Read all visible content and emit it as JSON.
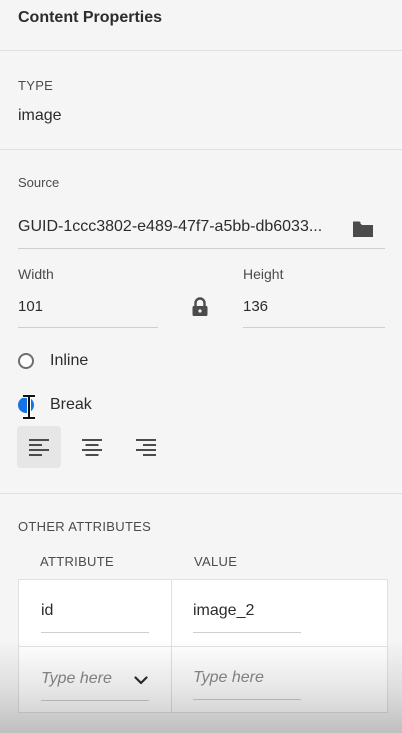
{
  "panel": {
    "title": "Content Properties"
  },
  "type_section": {
    "label": "TYPE",
    "value": "image"
  },
  "source": {
    "label": "Source",
    "value": "GUID-1ccc3802-e489-47f7-a5bb-db6033...",
    "browse_icon": "folder-icon"
  },
  "dimensions": {
    "width_label": "Width",
    "width_value": "101",
    "height_label": "Height",
    "height_value": "136",
    "lock_icon": "lock-icon"
  },
  "layout": {
    "inline_label": "Inline",
    "break_label": "Break",
    "selected": "Break"
  },
  "alignment": {
    "options": [
      "align-left",
      "align-center",
      "align-right"
    ],
    "selected": "align-left"
  },
  "other_attributes": {
    "label": "OTHER ATTRIBUTES",
    "col_attribute": "ATTRIBUTE",
    "col_value": "VALUE",
    "rows": [
      {
        "attribute": "id",
        "value": "image_2"
      }
    ],
    "new_row": {
      "attribute_placeholder": "Type here",
      "value_placeholder": "Type here"
    }
  },
  "colors": {
    "accent": "#1473e6",
    "background": "#f5f5f5"
  }
}
